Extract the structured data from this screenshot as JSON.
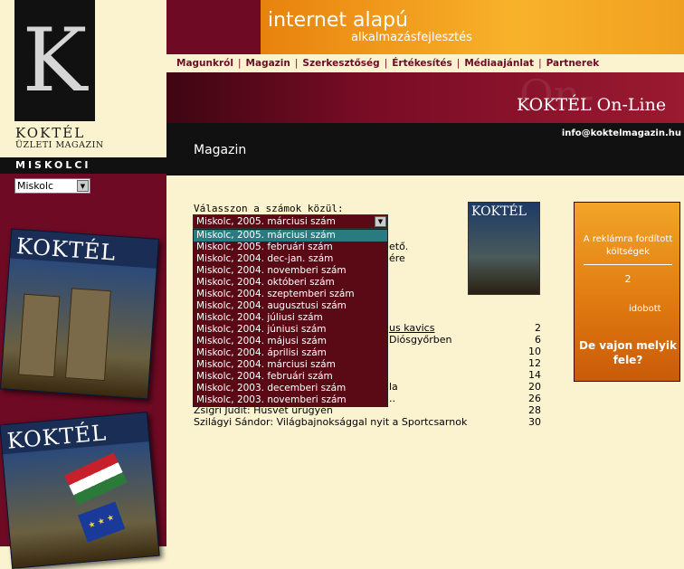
{
  "logo": {
    "letter": "K",
    "name": "KOKTÉL",
    "subtitle": "ÜZLETI MAGAZIN"
  },
  "city": {
    "label": "MISKOLCI",
    "selected": "Miskolc"
  },
  "covers": [
    {
      "title": "KOKTÉL"
    },
    {
      "title": "KOKTÉL"
    }
  ],
  "banner": {
    "line1": "internet alapú",
    "line2": "alkalmazásfejlesztés"
  },
  "nav": [
    "Magunkról",
    "Magazin",
    "Szerkesztőség",
    "Értékesítés",
    "Médiaajánlat",
    "Partnerek"
  ],
  "site": {
    "title": "KOKTÉL On-Line",
    "ghost": "On-Line",
    "email": "info@koktelmagazin.hu"
  },
  "section": {
    "title": "Magazin"
  },
  "issues": {
    "label": "Válasszon a számok közül:",
    "selected": "Miskolc, 2005. márciusi szám",
    "options": [
      "Miskolc, 2005. márciusi szám",
      "Miskolc, 2005. februári szám",
      "Miskolc, 2004. dec-jan. szám",
      "Miskolc, 2004. novemberi szám",
      "Miskolc, 2004. októberi szám",
      "Miskolc, 2004. szeptemberi szám",
      "Miskolc, 2004. augusztusi szám",
      "Miskolc, 2004. júliusi szám",
      "Miskolc, 2004. júniusi szám",
      "Miskolc, 2004. májusi szám",
      "Miskolc, 2004. áprilisi szám",
      "Miskolc, 2004. márciusi szám",
      "Miskolc, 2004. februári szám",
      "Miskolc, 2003. decemberi szám",
      "Miskolc, 2003. novemberi szám"
    ]
  },
  "thumb": {
    "title": "KOKTÉL"
  },
  "peek": {
    "a": "ető.",
    "b": "ére",
    "c": "us kavics",
    "d": "Diósgyőrben",
    "e": "la",
    "f": ".."
  },
  "pages": [
    "2",
    "6",
    "10",
    "12",
    "14",
    "20",
    "26"
  ],
  "toc": [
    {
      "title": "Zsigri Judit: Húsvét ürügyén",
      "page": "28"
    },
    {
      "title": "Szilágyi Sándor: Világbajnoksággal nyit a Sportcsarnok",
      "page": "30"
    }
  ],
  "ad": {
    "text1": "A reklámra fordított költségek",
    "num": "2",
    "frag": "idobott",
    "question": "De vajon melyik fele?"
  }
}
